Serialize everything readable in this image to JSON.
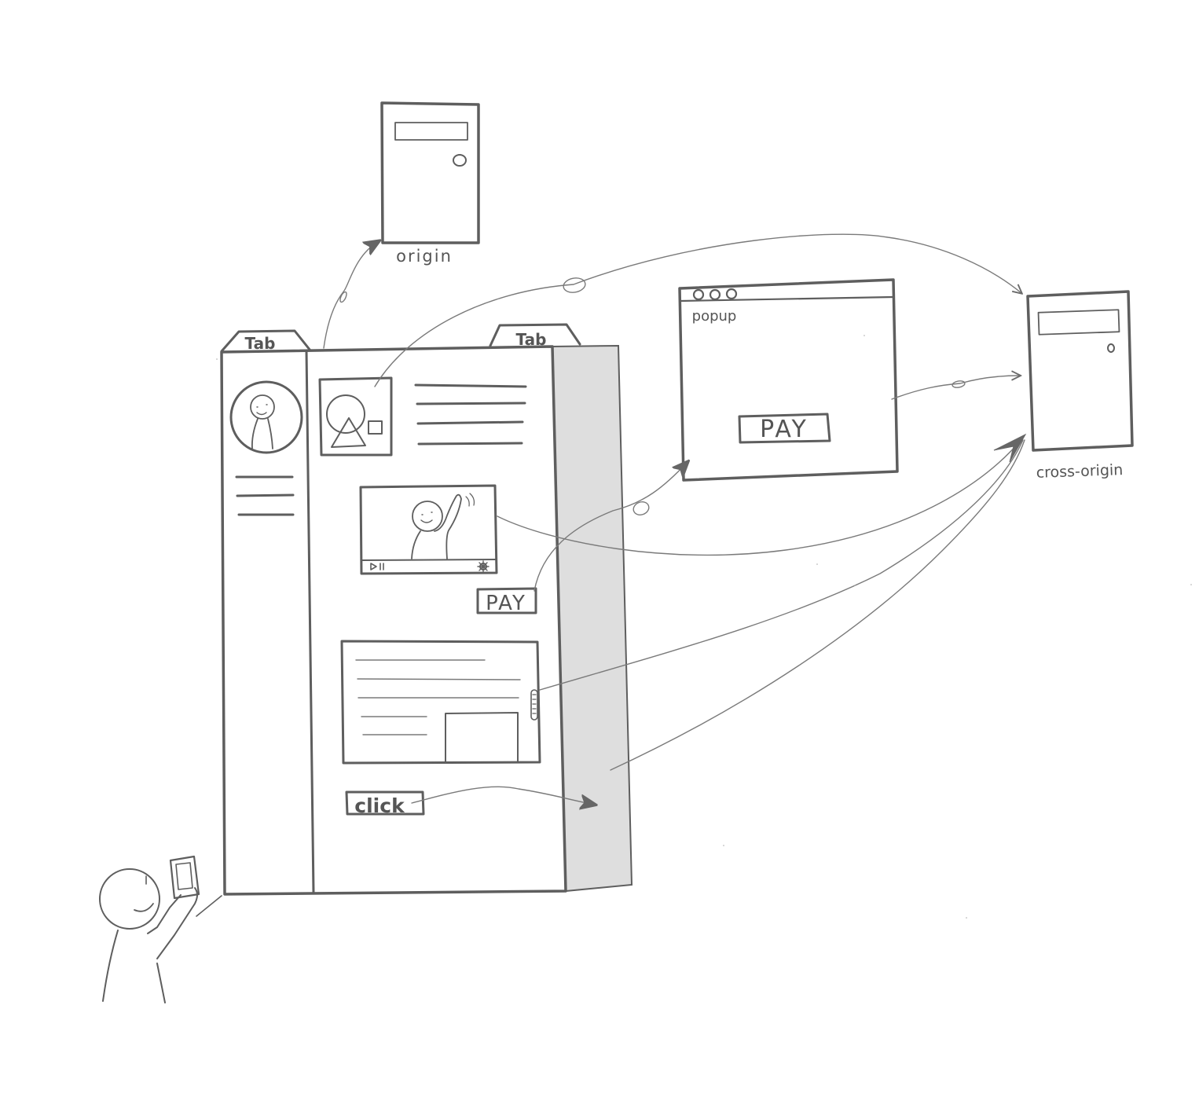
{
  "labels": {
    "tab_left": "Tab",
    "tab_right": "Tab",
    "origin": "origin",
    "cross_origin": "cross-origin",
    "popup": "popup",
    "pay_in_page": "PAY",
    "pay_in_popup": "PAY",
    "click": "click"
  },
  "colors": {
    "ink": "#5e5e5e",
    "shade": "#dedede",
    "background": "#ffffff"
  }
}
